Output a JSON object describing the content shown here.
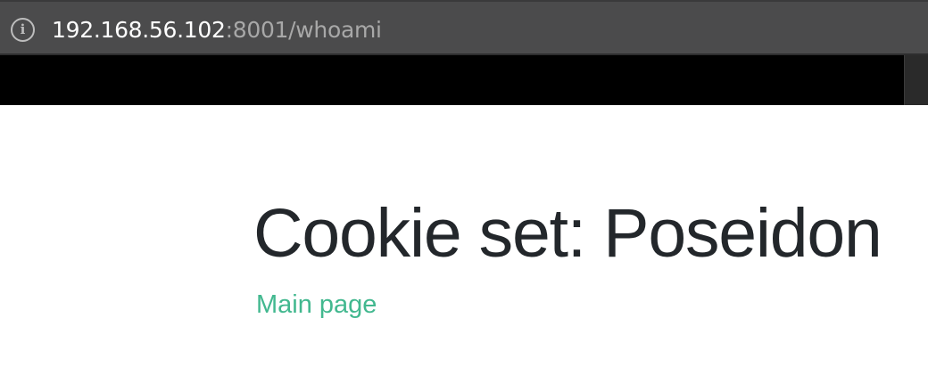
{
  "browser": {
    "url_host": "192.168.56.102",
    "url_rest": ":8001/whoami",
    "info_icon_glyph": "i"
  },
  "page": {
    "heading": "Cookie set: Poseidon",
    "link_label": "Main page"
  },
  "colors": {
    "toolbar_bg": "#4b4b4c",
    "band_bg": "#000000",
    "heading_color": "#23272b",
    "link_color": "#42b88f"
  },
  "icons": {
    "site_info": "info-icon"
  }
}
